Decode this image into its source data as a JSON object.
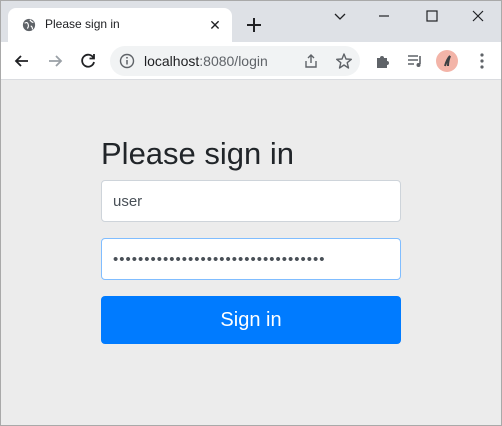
{
  "browser": {
    "tab": {
      "title": "Please sign in",
      "favicon": "globe-icon",
      "close": "✕"
    },
    "new_tab": "plus-icon",
    "window_controls": [
      "chevron-down-icon",
      "minimize-icon",
      "maximize-icon",
      "close-icon"
    ],
    "address": {
      "host": "localhost",
      "rest": ":8080/login"
    },
    "toolbar_icons": [
      "back-icon",
      "forward-icon",
      "reload-icon",
      "info-icon",
      "share-icon",
      "star-icon",
      "extensions-icon",
      "media-icon",
      "avatar",
      "menu-icon"
    ]
  },
  "page": {
    "heading": "Please sign in",
    "username": {
      "value": "user"
    },
    "password": {
      "masked": "••••••••••••••••••••••••••••••••••"
    },
    "submit_label": "Sign in"
  },
  "colors": {
    "primary": "#007bff",
    "page_bg": "#ececec",
    "tabstrip_bg": "#dee1e6"
  }
}
